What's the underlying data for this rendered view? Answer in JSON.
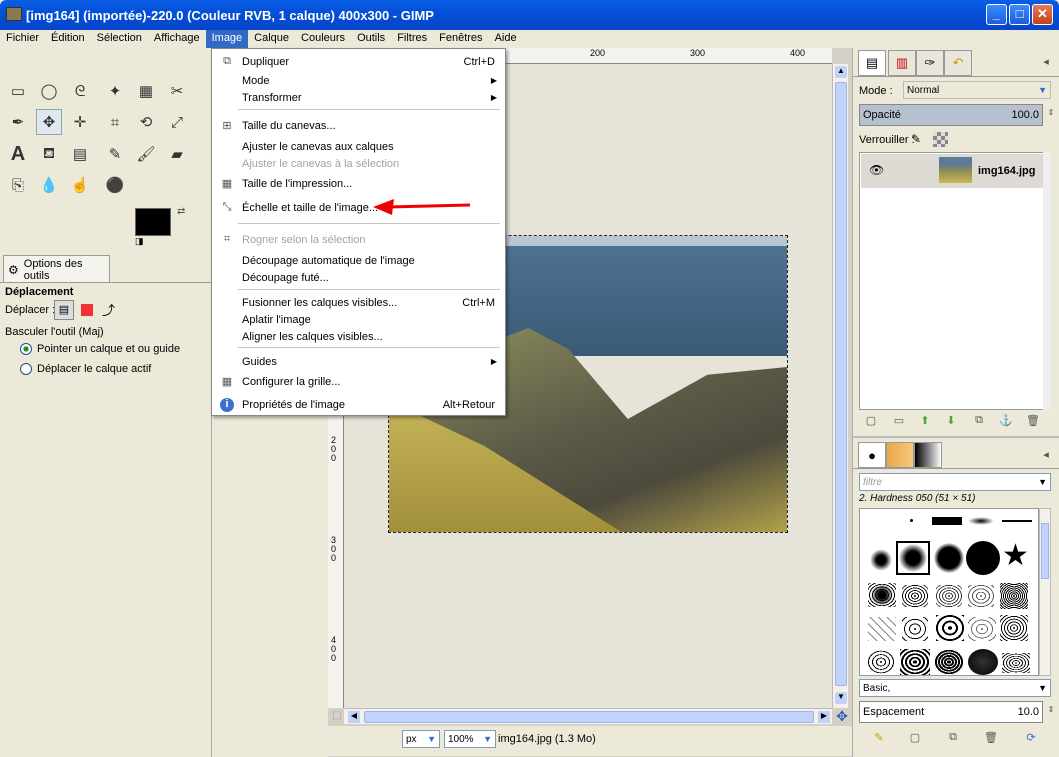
{
  "window": {
    "title": "[img164] (importée)-220.0 (Couleur RVB, 1 calque) 400x300 - GIMP"
  },
  "menubar": [
    "Fichier",
    "Édition",
    "Sélection",
    "Affichage",
    "Image",
    "Calque",
    "Couleurs",
    "Outils",
    "Filtres",
    "Fenêtres",
    "Aide"
  ],
  "toolbox": {
    "options_tab": "Options des outils",
    "tool_name": "Déplacement",
    "move_label": "Déplacer :",
    "toggle_label": "Basculer l'outil  (Maj)",
    "radio1": "Pointer un calque et ou guide",
    "radio2": "Déplacer le calque actif"
  },
  "image_menu": {
    "items": [
      {
        "label": "Dupliquer",
        "shortcut": "Ctrl+D"
      },
      {
        "label": "Mode",
        "shortcut": ""
      },
      {
        "label": "Transformer",
        "shortcut": ""
      },
      {
        "label": "Taille du canevas...",
        "shortcut": ""
      },
      {
        "label": "Ajuster le canevas aux calques",
        "shortcut": ""
      },
      {
        "label": "Ajuster le canevas à la sélection",
        "shortcut": ""
      },
      {
        "label": "Taille de l'impression...",
        "shortcut": ""
      },
      {
        "label": "Échelle et taille de l'image...",
        "shortcut": ""
      },
      {
        "label": "Rogner selon la sélection",
        "shortcut": ""
      },
      {
        "label": "Découpage automatique de l'image",
        "shortcut": ""
      },
      {
        "label": "Découpage futé...",
        "shortcut": ""
      },
      {
        "label": "Fusionner les calques visibles...",
        "shortcut": "Ctrl+M"
      },
      {
        "label": "Aplatir l'image",
        "shortcut": ""
      },
      {
        "label": "Aligner les calques visibles...",
        "shortcut": ""
      },
      {
        "label": "Guides",
        "shortcut": ""
      },
      {
        "label": "Configurer la grille...",
        "shortcut": ""
      },
      {
        "label": "Propriétés de l'image",
        "shortcut": "Alt+Retour"
      }
    ]
  },
  "ruler": {
    "top": [
      "200",
      "300",
      "400"
    ],
    "left": [
      "200",
      "300",
      "400"
    ]
  },
  "status": {
    "unit": "px",
    "zoom": "100%",
    "file": "img164.jpg (1.3 Mo)"
  },
  "layers": {
    "mode_label": "Mode :",
    "mode_value": "Normal",
    "opacity_label": "Opacité",
    "opacity_value": "100.0",
    "lock_label": "Verrouiller :",
    "layer_name": "img164.jpg"
  },
  "brushes": {
    "filter_placeholder": "filtre",
    "brush_title": "2. Hardness 050 (51 × 51)",
    "preset": "Basic,",
    "spacing_label": "Espacement",
    "spacing_value": "10.0"
  }
}
